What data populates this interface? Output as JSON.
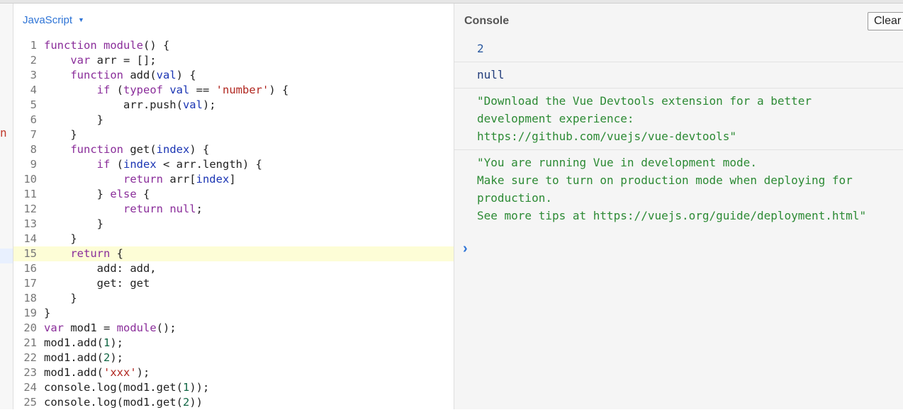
{
  "editor": {
    "language": "JavaScript",
    "gutter_marker": "n",
    "active_line": 15,
    "lines": [
      {
        "n": "1",
        "tokens": [
          {
            "t": "function module",
            "c": "kw"
          },
          {
            "t": "() {",
            "c": "plain"
          }
        ]
      },
      {
        "n": "2",
        "tokens": [
          {
            "t": "    var ",
            "c": "kw"
          },
          {
            "t": "arr = [];",
            "c": "plain"
          }
        ]
      },
      {
        "n": "3",
        "tokens": [
          {
            "t": "    function ",
            "c": "kw"
          },
          {
            "t": "add(",
            "c": "plain"
          },
          {
            "t": "val",
            "c": "var"
          },
          {
            "t": ") {",
            "c": "plain"
          }
        ]
      },
      {
        "n": "4",
        "tokens": [
          {
            "t": "        if ",
            "c": "kw"
          },
          {
            "t": "(",
            "c": "plain"
          },
          {
            "t": "typeof ",
            "c": "kw"
          },
          {
            "t": "val",
            "c": "var"
          },
          {
            "t": " == ",
            "c": "plain"
          },
          {
            "t": "'number'",
            "c": "str"
          },
          {
            "t": ") {",
            "c": "plain"
          }
        ]
      },
      {
        "n": "5",
        "tokens": [
          {
            "t": "            arr.push(",
            "c": "plain"
          },
          {
            "t": "val",
            "c": "var"
          },
          {
            "t": ");",
            "c": "plain"
          }
        ]
      },
      {
        "n": "6",
        "tokens": [
          {
            "t": "        }",
            "c": "plain"
          }
        ]
      },
      {
        "n": "7",
        "tokens": [
          {
            "t": "    }",
            "c": "plain"
          }
        ]
      },
      {
        "n": "8",
        "tokens": [
          {
            "t": "    function ",
            "c": "kw"
          },
          {
            "t": "get(",
            "c": "plain"
          },
          {
            "t": "index",
            "c": "var"
          },
          {
            "t": ") {",
            "c": "plain"
          }
        ]
      },
      {
        "n": "9",
        "tokens": [
          {
            "t": "        if ",
            "c": "kw"
          },
          {
            "t": "(",
            "c": "plain"
          },
          {
            "t": "index",
            "c": "var"
          },
          {
            "t": " < arr.length) {",
            "c": "plain"
          }
        ]
      },
      {
        "n": "10",
        "tokens": [
          {
            "t": "            return ",
            "c": "kw"
          },
          {
            "t": "arr[",
            "c": "plain"
          },
          {
            "t": "index",
            "c": "var"
          },
          {
            "t": "]",
            "c": "plain"
          }
        ]
      },
      {
        "n": "11",
        "tokens": [
          {
            "t": "        } ",
            "c": "plain"
          },
          {
            "t": "else",
            "c": "kw"
          },
          {
            "t": " {",
            "c": "plain"
          }
        ]
      },
      {
        "n": "12",
        "tokens": [
          {
            "t": "            return ",
            "c": "kw"
          },
          {
            "t": "null",
            "c": "kw"
          },
          {
            "t": ";",
            "c": "plain"
          }
        ]
      },
      {
        "n": "13",
        "tokens": [
          {
            "t": "        }",
            "c": "plain"
          }
        ]
      },
      {
        "n": "14",
        "tokens": [
          {
            "t": "    }",
            "c": "plain"
          }
        ]
      },
      {
        "n": "15",
        "tokens": [
          {
            "t": "    return ",
            "c": "kw"
          },
          {
            "t": "{",
            "c": "plain"
          }
        ]
      },
      {
        "n": "16",
        "tokens": [
          {
            "t": "        add: add,",
            "c": "plain"
          }
        ]
      },
      {
        "n": "17",
        "tokens": [
          {
            "t": "        get: get",
            "c": "plain"
          }
        ]
      },
      {
        "n": "18",
        "tokens": [
          {
            "t": "    }",
            "c": "plain"
          }
        ]
      },
      {
        "n": "19",
        "tokens": [
          {
            "t": "}",
            "c": "plain"
          }
        ]
      },
      {
        "n": "20",
        "tokens": [
          {
            "t": "var ",
            "c": "kw"
          },
          {
            "t": "mod1 = ",
            "c": "plain"
          },
          {
            "t": "module",
            "c": "kw"
          },
          {
            "t": "();",
            "c": "plain"
          }
        ]
      },
      {
        "n": "21",
        "tokens": [
          {
            "t": "mod1.add(",
            "c": "plain"
          },
          {
            "t": "1",
            "c": "num"
          },
          {
            "t": ");",
            "c": "plain"
          }
        ]
      },
      {
        "n": "22",
        "tokens": [
          {
            "t": "mod1.add(",
            "c": "plain"
          },
          {
            "t": "2",
            "c": "num"
          },
          {
            "t": ");",
            "c": "plain"
          }
        ]
      },
      {
        "n": "23",
        "tokens": [
          {
            "t": "mod1.add(",
            "c": "plain"
          },
          {
            "t": "'xxx'",
            "c": "str"
          },
          {
            "t": ");",
            "c": "plain"
          }
        ]
      },
      {
        "n": "24",
        "tokens": [
          {
            "t": "console.log(mod1.get(",
            "c": "plain"
          },
          {
            "t": "1",
            "c": "num"
          },
          {
            "t": "));",
            "c": "plain"
          }
        ]
      },
      {
        "n": "25",
        "tokens": [
          {
            "t": "console.log(mod1.get(",
            "c": "plain"
          },
          {
            "t": "2",
            "c": "num"
          },
          {
            "t": "))",
            "c": "plain"
          }
        ]
      }
    ]
  },
  "console": {
    "title": "Console",
    "clear_label": "Clear",
    "prompt_icon": "prompt-chevron-icon",
    "prompt_glyph": "›",
    "entries": [
      {
        "kind": "number",
        "text": "2"
      },
      {
        "kind": "null",
        "text": "null"
      },
      {
        "kind": "string",
        "text": "\"Download the Vue Devtools extension for a better\ndevelopment experience:\nhttps://github.com/vuejs/vue-devtools\""
      },
      {
        "kind": "string",
        "text": "\"You are running Vue in development mode.\nMake sure to turn on production mode when deploying for\nproduction.\nSee more tips at https://vuejs.org/guide/deployment.html\""
      }
    ]
  },
  "colors": {
    "keyword": "#8a2d9a",
    "variable": "#1a34b3",
    "string": "#b0261f",
    "number": "#116644",
    "console_string": "#2c8a34",
    "accent": "#2e74d6",
    "active_line_bg": "#fdfdd6"
  }
}
